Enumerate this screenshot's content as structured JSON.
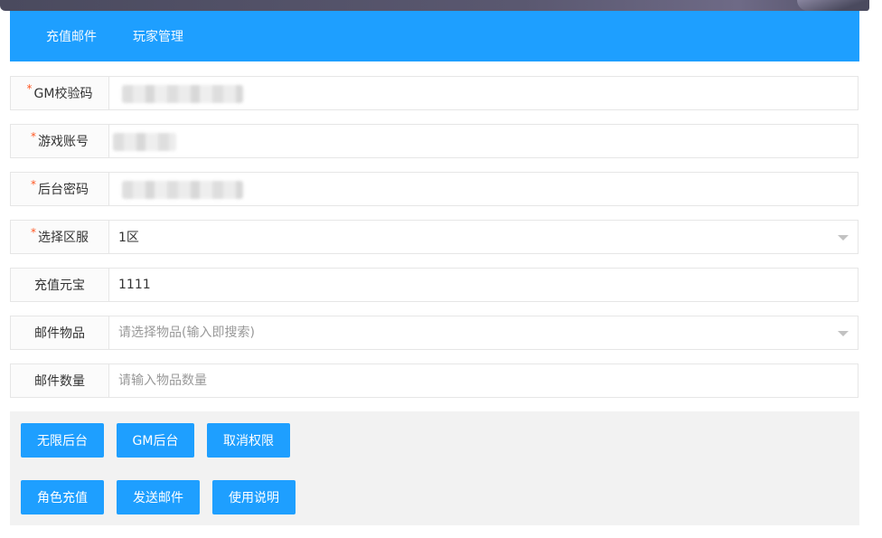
{
  "nav": {
    "items": [
      {
        "label": "充值邮件"
      },
      {
        "label": "玩家管理"
      }
    ]
  },
  "form": {
    "gm_code": {
      "label": "GM校验码",
      "required": true
    },
    "account": {
      "label": "游戏账号",
      "required": true
    },
    "password": {
      "label": "后台密码",
      "required": true
    },
    "server": {
      "label": "选择区服",
      "required": true,
      "value": "1区"
    },
    "yuanbao": {
      "label": "充值元宝",
      "value": "1111"
    },
    "item": {
      "label": "邮件物品",
      "placeholder": "请选择物品(输入即搜索)"
    },
    "quantity": {
      "label": "邮件数量",
      "placeholder": "请输入物品数量"
    }
  },
  "buttons": {
    "unlimited": "无限后台",
    "gm": "GM后台",
    "revoke": "取消权限",
    "recharge": "角色充值",
    "send_mail": "发送邮件",
    "help": "使用说明"
  },
  "colors": {
    "primary": "#1e9fff",
    "required": "#ff5722",
    "panel": "#f2f2f2"
  }
}
